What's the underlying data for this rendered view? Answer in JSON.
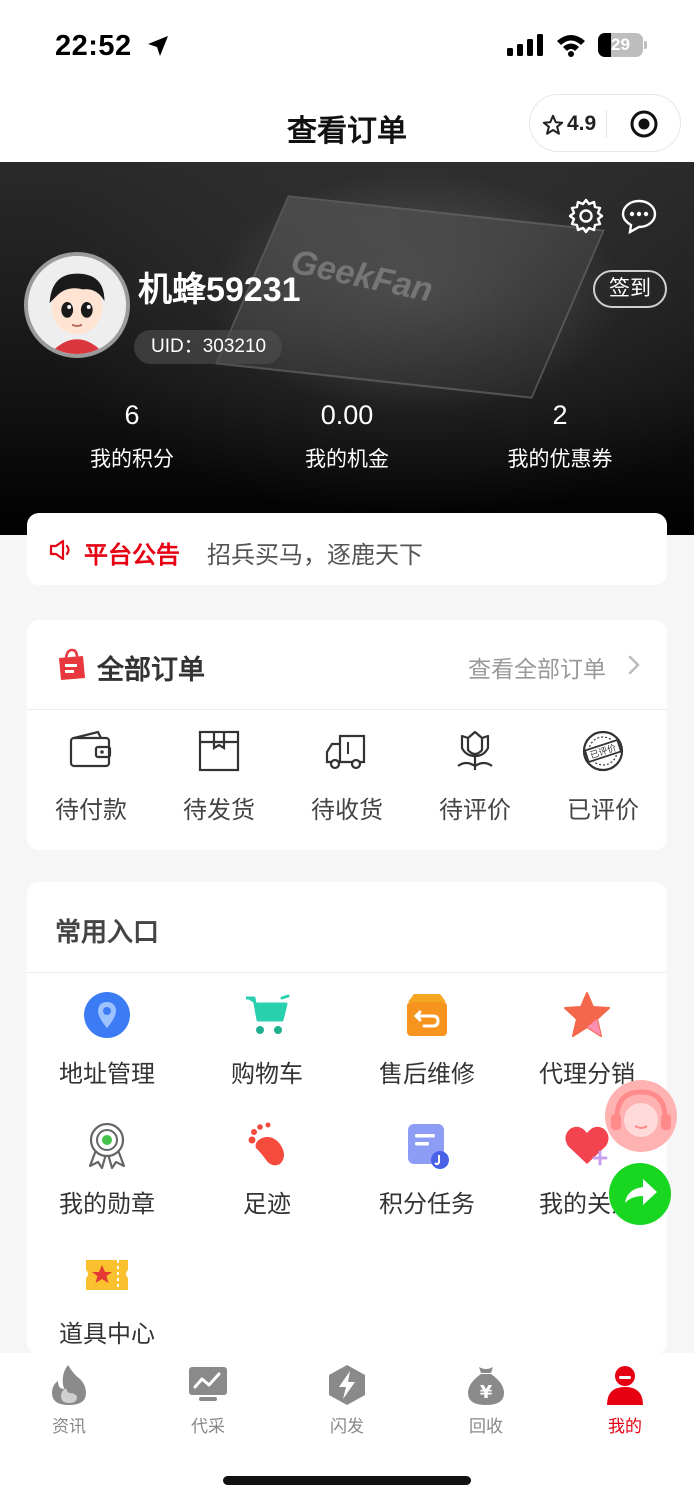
{
  "status_bar": {
    "time": "22:52",
    "battery": "29"
  },
  "nav": {
    "title": "查看订单",
    "rating": "4.9"
  },
  "profile": {
    "username": "机蜂59231",
    "uid": "UID：303210",
    "checkin_label": "签到",
    "banner_text": "GeekFan",
    "stats": [
      {
        "value": "6",
        "label": "我的积分"
      },
      {
        "value": "0.00",
        "label": "我的机金"
      },
      {
        "value": "2",
        "label": "我的优惠券"
      }
    ]
  },
  "notice": {
    "title": "平台公告",
    "text": "招兵买马，逐鹿天下"
  },
  "orders": {
    "title": "全部订单",
    "view_all": "查看全部订单",
    "items": [
      {
        "label": "待付款",
        "icon": "wallet-icon"
      },
      {
        "label": "待发货",
        "icon": "box-icon"
      },
      {
        "label": "待收货",
        "icon": "truck-icon"
      },
      {
        "label": "待评价",
        "icon": "flower-icon"
      },
      {
        "label": "已评价",
        "icon": "stamp-icon",
        "stamp_text": "已评价"
      }
    ]
  },
  "entries": {
    "title": "常用入口",
    "items": [
      {
        "label": "地址管理",
        "icon": "location-icon"
      },
      {
        "label": "购物车",
        "icon": "cart-icon"
      },
      {
        "label": "售后维修",
        "icon": "return-box-icon"
      },
      {
        "label": "代理分销",
        "icon": "star-icon"
      },
      {
        "label": "我的勋章",
        "icon": "medal-icon"
      },
      {
        "label": "足迹",
        "icon": "footprint-icon"
      },
      {
        "label": "积分任务",
        "icon": "task-icon"
      },
      {
        "label": "我的关注",
        "icon": "heart-icon"
      },
      {
        "label": "道具中心",
        "icon": "ticket-icon"
      }
    ]
  },
  "tabbar": {
    "items": [
      {
        "label": "资讯",
        "icon": "flame-icon",
        "active": false
      },
      {
        "label": "代采",
        "icon": "monitor-icon",
        "active": false
      },
      {
        "label": "闪发",
        "icon": "lightning-icon",
        "active": false
      },
      {
        "label": "回收",
        "icon": "money-bag-icon",
        "active": false
      },
      {
        "label": "我的",
        "icon": "user-icon",
        "active": true
      }
    ],
    "recycle_symbol": "¥"
  },
  "colors": {
    "accent": "#e60012",
    "share": "#19d620"
  }
}
